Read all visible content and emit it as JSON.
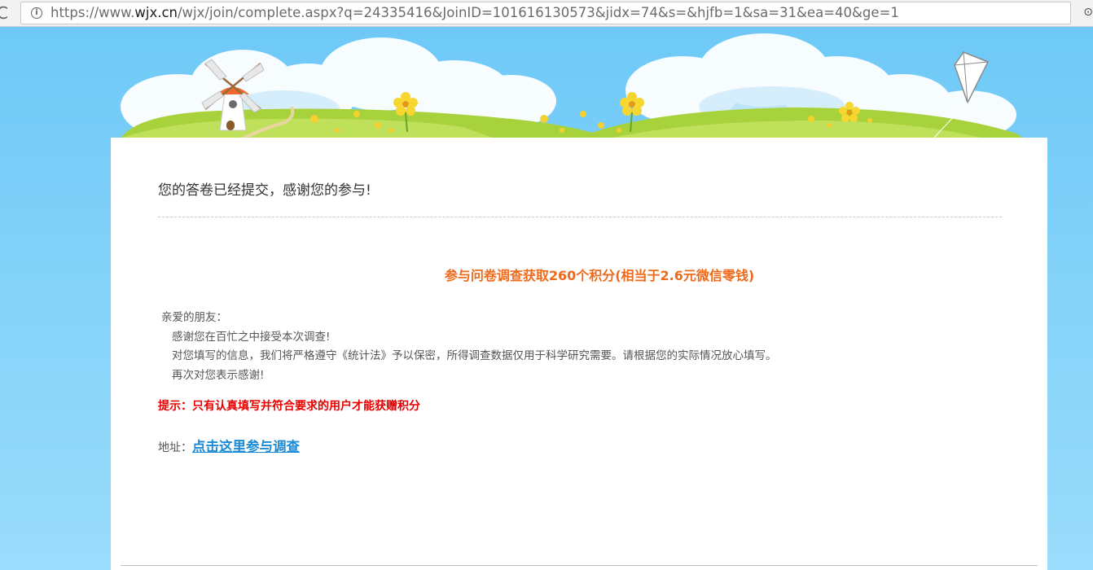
{
  "browser": {
    "url_prefix": "https://www.",
    "url_domain": "wjx.cn",
    "url_path": "/wjx/join/complete.aspx?q=24335416&JoinID=101616130573&jidx=74&s=&hjfb=1&sa=31&ea=40&ge=1",
    "reload_glyph": "C",
    "info_glyph": "i",
    "extension_glyph": "⊙"
  },
  "page": {
    "title": "您的答卷已经提交，感谢您的参与!",
    "reward": "参与问卷调查获取260个积分(相当于2.6元微信零钱)",
    "letter": {
      "greeting": "亲爱的朋友：",
      "line1": "感谢您在百忙之中接受本次调查!",
      "line2": "对您填写的信息，我们将严格遵守《统计法》予以保密，所得调查数据仅用于科学研究需要。请根据您的实际情况放心填写。",
      "line3": "再次对您表示感谢!"
    },
    "tip": "提示：只有认真填写并符合要求的用户才能获赠积分",
    "address_label": "地址：",
    "address_link": "点击这里参与调查"
  },
  "colors": {
    "reward": "#ee6a1c",
    "tip": "#e60000",
    "link": "#1a8ad6",
    "sky": "#6cc8f7"
  }
}
